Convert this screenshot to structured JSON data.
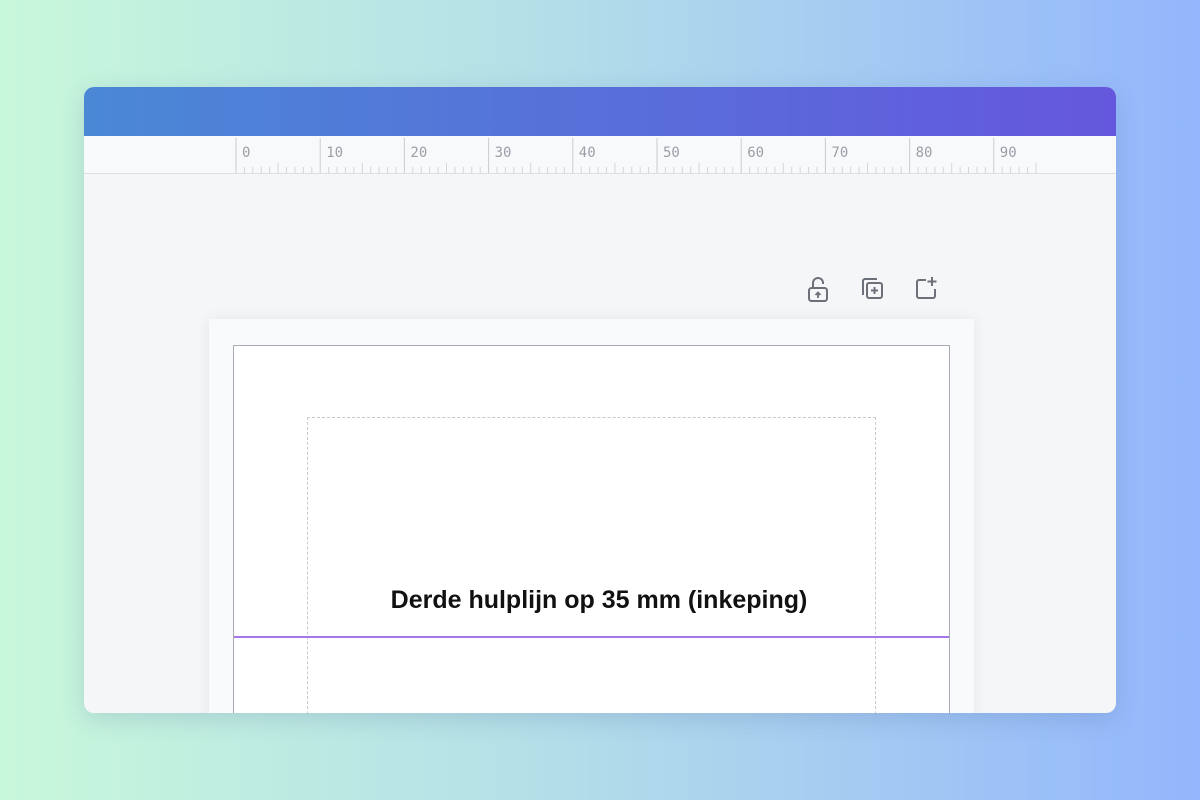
{
  "ruler": {
    "marks": [
      "0",
      "10",
      "20",
      "30",
      "40",
      "50",
      "60",
      "70",
      "80",
      "90"
    ]
  },
  "toolbar": {
    "lock_icon": "unlock-icon",
    "duplicate_icon": "duplicate-page-icon",
    "add_icon": "add-page-icon"
  },
  "canvas": {
    "guide_label": "Derde hulplijn op 35 mm (inkeping)"
  },
  "colors": {
    "titlebar_start": "#4a88d6",
    "titlebar_end": "#6557dd",
    "guide": "#a777ea"
  }
}
